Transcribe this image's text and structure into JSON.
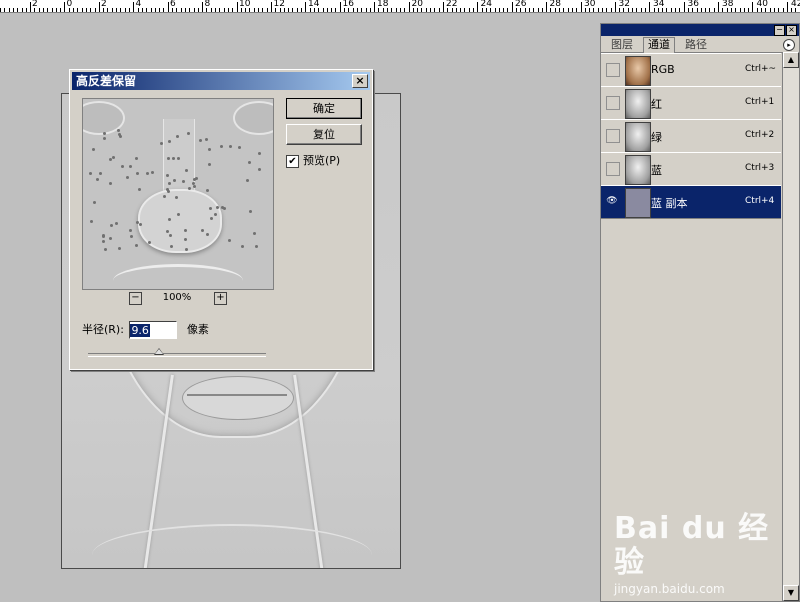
{
  "ruler": {
    "labels": [
      "2",
      "0",
      "2",
      "4",
      "6",
      "8",
      "10",
      "12",
      "14",
      "16",
      "18",
      "20",
      "22",
      "24",
      "26",
      "28",
      "30",
      "32",
      "34",
      "36",
      "38",
      "40",
      "42"
    ]
  },
  "dialog": {
    "title": "高反差保留",
    "close_label": "×",
    "ok_label": "确定",
    "reset_label": "复位",
    "preview_label": "预览(P)",
    "preview_checked": "✔",
    "zoom_minus": "−",
    "zoom_plus": "+",
    "zoom_value": "100%",
    "radius_label": "半径(R):",
    "radius_value": "9.6",
    "radius_unit": "像素",
    "slider_position": 0.4
  },
  "panel": {
    "tabs": [
      "图层",
      "通道",
      "路径"
    ],
    "active_tab": "通道",
    "menu_icon": "▸",
    "min_icon": "−",
    "close_icon": "×",
    "channels": [
      {
        "name": "RGB",
        "shortcut": "Ctrl+~",
        "visible": false,
        "selected": false,
        "thumb": "rgb"
      },
      {
        "name": "红",
        "shortcut": "Ctrl+1",
        "visible": false,
        "selected": false,
        "thumb": "gray"
      },
      {
        "name": "绿",
        "shortcut": "Ctrl+2",
        "visible": false,
        "selected": false,
        "thumb": "gray"
      },
      {
        "name": "蓝",
        "shortcut": "Ctrl+3",
        "visible": false,
        "selected": false,
        "thumb": "gray"
      },
      {
        "name": "蓝 副本",
        "shortcut": "Ctrl+4",
        "visible": true,
        "selected": true,
        "thumb": "flat"
      }
    ],
    "eye_icon": "👁",
    "scroll_up": "▲",
    "scroll_down": "▼"
  },
  "watermark": {
    "logo": "Bai du 经验",
    "url": "jingyan.baidu.com"
  }
}
